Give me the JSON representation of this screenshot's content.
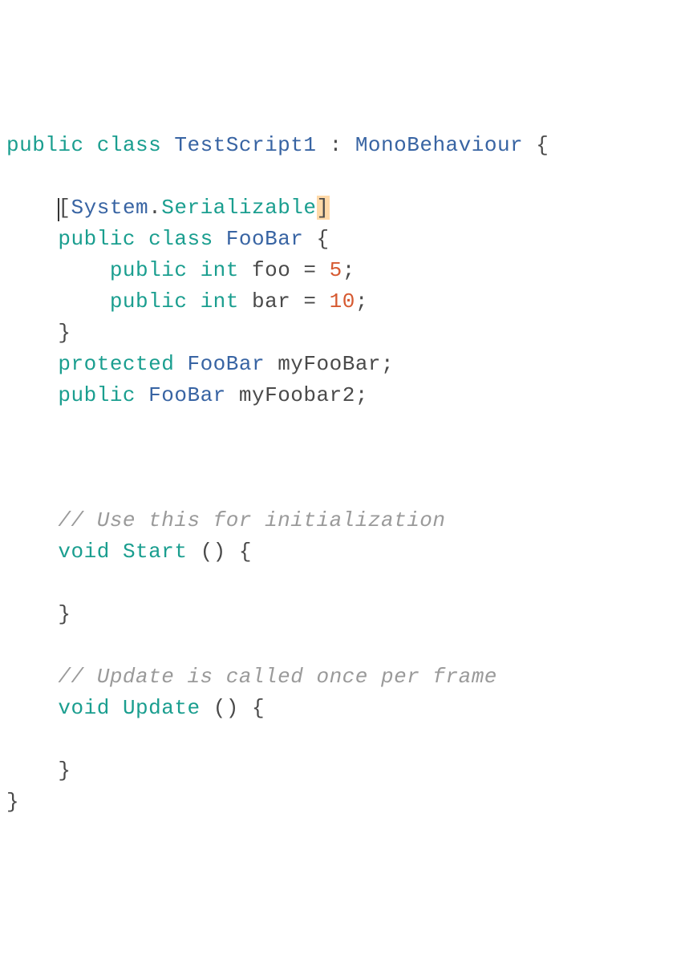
{
  "code": {
    "line1": {
      "kw1": "public",
      "kw2": "class",
      "classname": "TestScript1",
      "colon": ":",
      "basename": "MonoBehaviour",
      "brace": "{"
    },
    "line3": {
      "lbracket": "[",
      "ns": "System",
      "dot": ".",
      "attr": "Serializable",
      "rbracket": "]"
    },
    "line4": {
      "kw1": "public",
      "kw2": "class",
      "classname": "FooBar",
      "brace": "{"
    },
    "line5": {
      "kw1": "public",
      "kw2": "int",
      "ident": "foo",
      "eq": "=",
      "val": "5",
      "semi": ";"
    },
    "line6": {
      "kw1": "public",
      "kw2": "int",
      "ident": "bar",
      "eq": "=",
      "val": "10",
      "semi": ";"
    },
    "line7": {
      "brace": "}"
    },
    "line8": {
      "kw1": "protected",
      "type": "FooBar",
      "ident": "myFooBar",
      "semi": ";"
    },
    "line9": {
      "kw1": "public",
      "type": "FooBar",
      "ident": "myFoobar2",
      "semi": ";"
    },
    "line13": {
      "comment": "// Use this for initialization"
    },
    "line14": {
      "kw": "void",
      "method": "Start",
      "parens": "()",
      "brace": "{"
    },
    "line16": {
      "brace": "}"
    },
    "line18": {
      "comment": "// Update is called once per frame"
    },
    "line19": {
      "kw": "void",
      "method": "Update",
      "parens": "()",
      "brace": "{"
    },
    "line21": {
      "brace": "}"
    },
    "line22": {
      "brace": "}"
    }
  }
}
